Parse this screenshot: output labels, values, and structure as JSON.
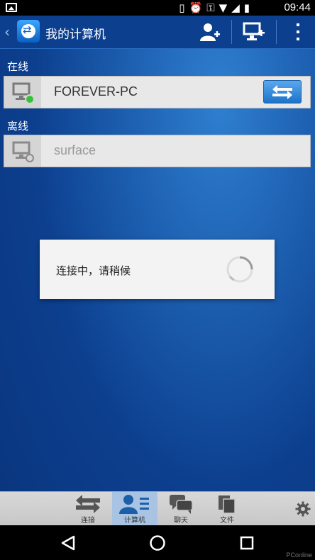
{
  "status_bar": {
    "time": "09:44",
    "icons": [
      "image-icon",
      "vibrate-icon",
      "alarm-icon",
      "key-icon",
      "wifi-icon",
      "signal-icon",
      "battery-charging-icon"
    ]
  },
  "action_bar": {
    "title": "我的计算机",
    "actions": [
      "add-contact-icon",
      "add-computer-icon",
      "overflow-menu-icon"
    ]
  },
  "sections": {
    "online_label": "在线",
    "offline_label": "离线"
  },
  "computers": {
    "online": {
      "name": "FOREVER-PC",
      "status": "online",
      "status_color": "#35c23b"
    },
    "offline": {
      "name": "surface",
      "status": "offline"
    }
  },
  "dialog": {
    "message": "连接中，请稍候"
  },
  "tabs": [
    {
      "label": "连接",
      "icon": "connect-arrows-icon",
      "active": false
    },
    {
      "label": "计算机",
      "icon": "computers-list-icon",
      "active": true
    },
    {
      "label": "聊天",
      "icon": "chat-icon",
      "active": false
    },
    {
      "label": "文件",
      "icon": "files-icon",
      "active": false
    }
  ],
  "watermark": "PConline",
  "colors": {
    "accent": "#1c73c8",
    "background": "#0c3f8e",
    "active_tab": "#a9c4e2"
  }
}
